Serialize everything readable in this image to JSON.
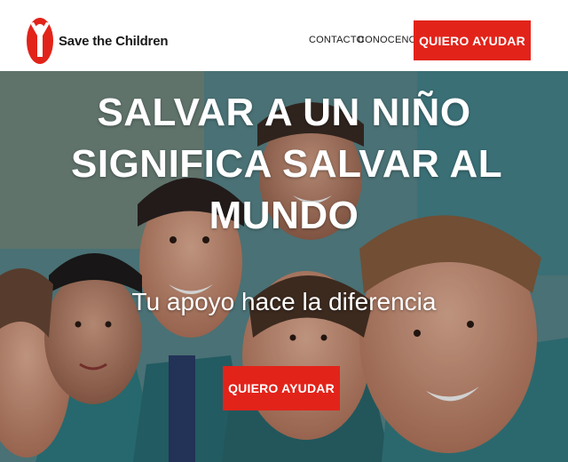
{
  "header": {
    "logo_text": "Save the Children",
    "nav": [
      {
        "label": "CONTACTO"
      },
      {
        "label": "CONOCENOS"
      }
    ],
    "cta_label": "QUIERO AYUDAR"
  },
  "hero": {
    "title_line1_plain": "SALVAR A UN ",
    "title_line1_bold": "NIÑO",
    "title_line2": "SIGNIFICA SALVAR AL",
    "title_line3_bold": "MUNDO",
    "subtitle": "Tu apoyo hace la diferencia",
    "cta_label": "QUIERO AYUDAR",
    "background_icon": "smiling-children-photo"
  },
  "colors": {
    "brand_red": "#e2231a",
    "header_bg": "#ffffff",
    "hero_text": "#ffffff"
  }
}
